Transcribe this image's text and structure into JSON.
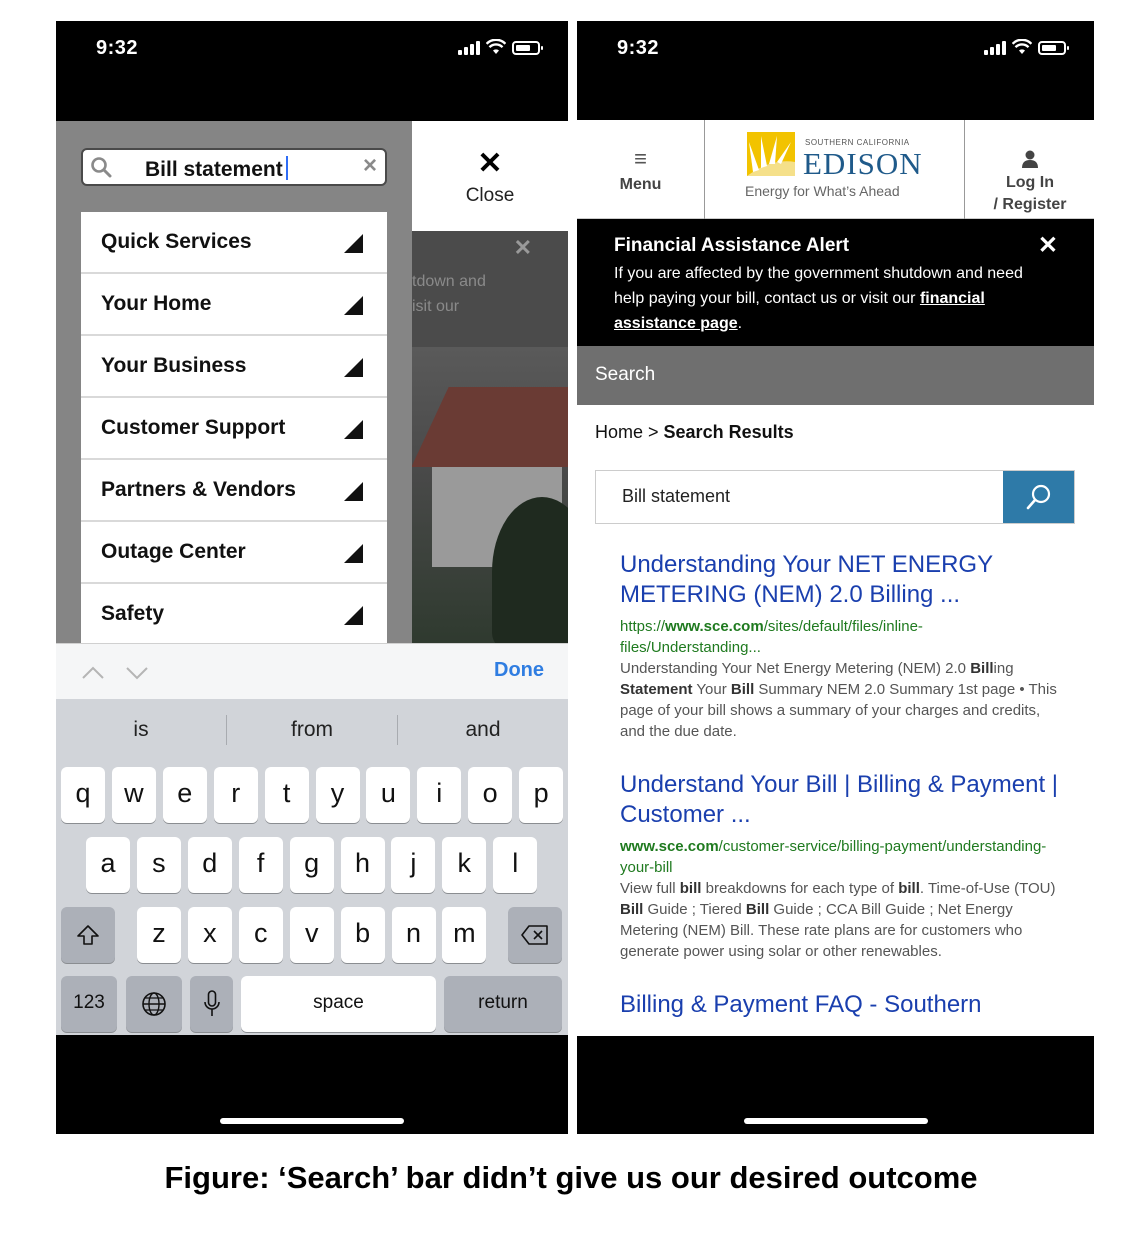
{
  "caption": "Figure: ‘Search’ bar didn’t give us our desired outcome",
  "left_phone": {
    "status_time": "9:32",
    "search_query": "Bill statement",
    "close_label": "Close",
    "background_alert_lines": [
      "tdown and",
      "isit our"
    ],
    "menu_items": [
      {
        "label": "Quick Services"
      },
      {
        "label": "Your Home"
      },
      {
        "label": "Your Business"
      },
      {
        "label": "Customer Support"
      },
      {
        "label": "Partners & Vendors"
      },
      {
        "label": "Outage Center"
      },
      {
        "label": "Safety"
      }
    ],
    "keyboard": {
      "done_label": "Done",
      "suggestions": [
        "is",
        "from",
        "and"
      ],
      "row1": [
        "q",
        "w",
        "e",
        "r",
        "t",
        "y",
        "u",
        "i",
        "o",
        "p"
      ],
      "row2": [
        "a",
        "s",
        "d",
        "f",
        "g",
        "h",
        "j",
        "k",
        "l"
      ],
      "row3": [
        "z",
        "x",
        "c",
        "v",
        "b",
        "n",
        "m"
      ],
      "numbers_label": "123",
      "space_label": "space",
      "return_label": "return"
    }
  },
  "right_phone": {
    "status_time": "9:32",
    "header": {
      "menu_label": "Menu",
      "logo_small": "SOUTHERN CALIFORNIA",
      "logo_name": "EDISON",
      "logo_tagline": "Energy for What’s Ahead",
      "login_label": "Log In\n/ Register"
    },
    "alert": {
      "title": "Financial Assistance Alert",
      "text": "If you are affected by the government shutdown and need help paying your bill, contact us or visit our",
      "link": "financial assistance page",
      "end": "."
    },
    "search_bar_label": "Search",
    "breadcrumb": {
      "home": "Home",
      "sep": " > ",
      "current": "Search Results"
    },
    "search_input": "Bill statement",
    "results": [
      {
        "title": "Understanding Your NET ENERGY METERING (NEM) 2.0 Billing ...",
        "url_prefix": "https://",
        "url_bold": "www.sce.com",
        "url_rest": "/sites/default/files/inline-files/Understanding...",
        "snippet": [
          {
            "t": "Understanding Your Net Energy Metering (NEM) 2.0 ",
            "b": false
          },
          {
            "t": "Bill",
            "b": true
          },
          {
            "t": "ing ",
            "b": false
          },
          {
            "t": "Statement",
            "b": true
          },
          {
            "t": " Your ",
            "b": false
          },
          {
            "t": "Bill",
            "b": true
          },
          {
            "t": " Summary NEM 2.0 Summary 1st page • This page of your bill shows a summary of your charges and credits, and the due date.",
            "b": false
          }
        ]
      },
      {
        "title": "Understand Your Bill | Billing & Payment | Customer ...",
        "url_prefix": "",
        "url_bold": "www.sce.com",
        "url_rest": "/customer-service/billing-payment/understanding-your-bill",
        "snippet": [
          {
            "t": "View full ",
            "b": false
          },
          {
            "t": "bill",
            "b": true
          },
          {
            "t": " breakdowns for each type of ",
            "b": false
          },
          {
            "t": "bill",
            "b": true
          },
          {
            "t": ". Time-of-Use (TOU) ",
            "b": false
          },
          {
            "t": "Bill",
            "b": true
          },
          {
            "t": " Guide ; Tiered ",
            "b": false
          },
          {
            "t": "Bill",
            "b": true
          },
          {
            "t": " Guide ; CCA Bill Guide ; Net Energy Metering (NEM) Bill. These rate plans are for customers who generate power using solar or other renewables.",
            "b": false
          }
        ]
      },
      {
        "title": "Billing & Payment FAQ - Southern",
        "url_prefix": "",
        "url_bold": "",
        "url_rest": "",
        "snippet": []
      }
    ]
  },
  "colors": {
    "link_blue": "#1a3fae",
    "url_green": "#1f7a1f",
    "search_button": "#2e7aa8",
    "done_blue": "#2f7de1"
  }
}
